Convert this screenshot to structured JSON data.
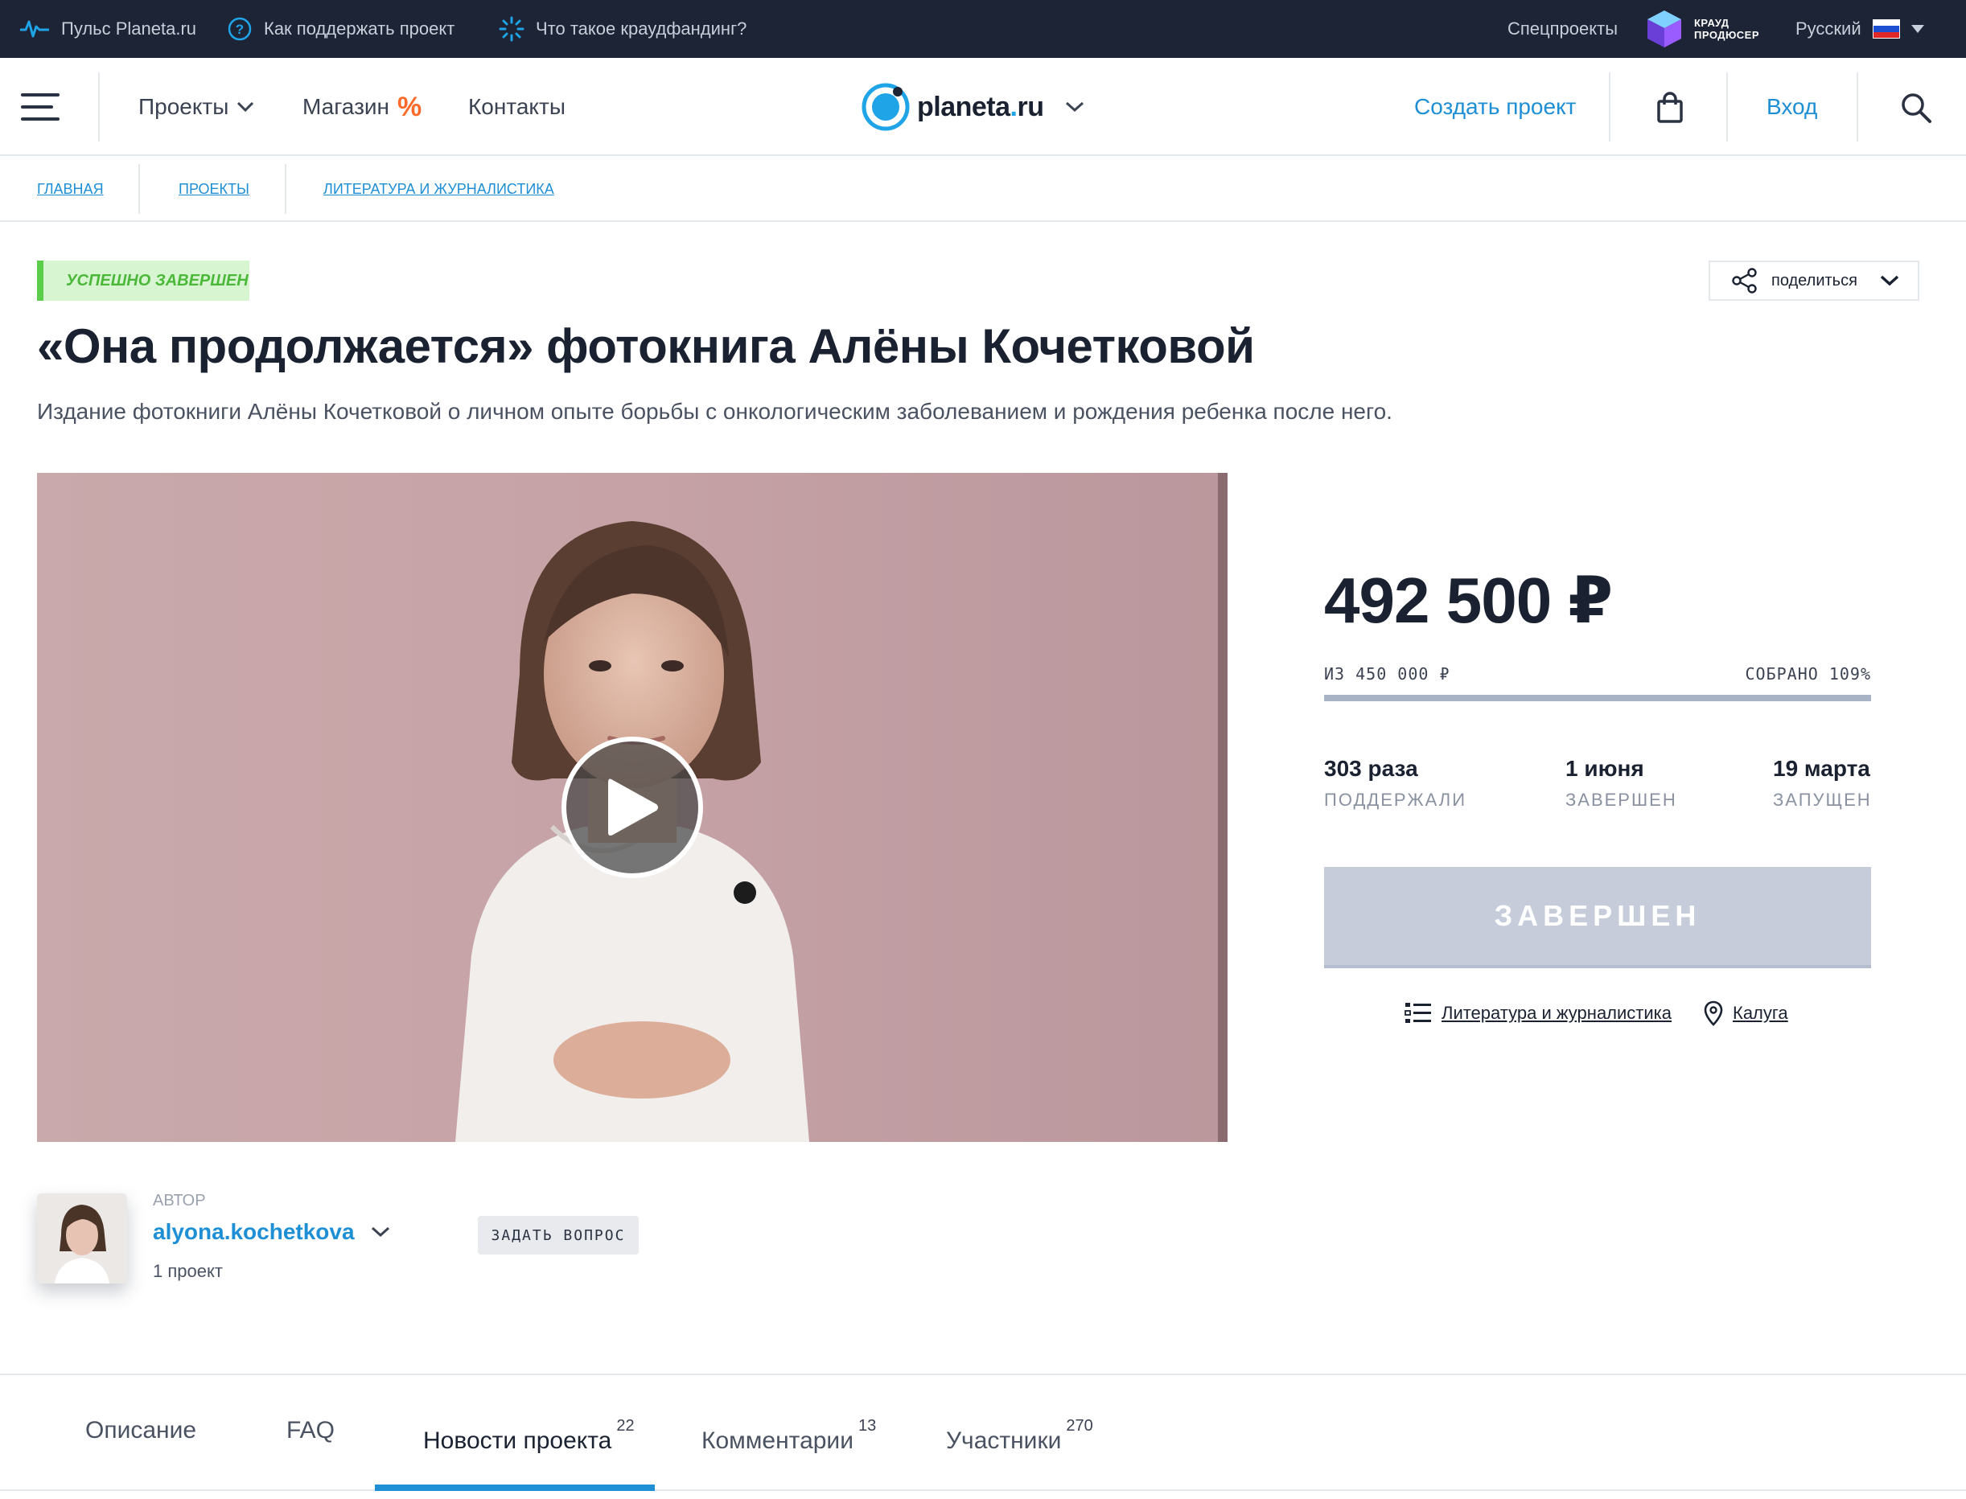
{
  "topbar": {
    "pulse": "Пульс Planeta.ru",
    "support": "Как поддержать проект",
    "crowdfunding": "Что такое краудфандинг?",
    "special": "Спецпроекты",
    "producer": "КРАУД\nПРОДЮСЕР",
    "language": "Русский",
    "colors": {
      "background": "#1c2436",
      "accent": "#1fa4e8"
    }
  },
  "header": {
    "nav": {
      "projects": "Проекты",
      "shop": "Магазин",
      "shop_badge": "%",
      "contacts": "Контакты"
    },
    "logo": {
      "name": "planeta",
      "dot": ".",
      "tld": "ru"
    },
    "create_project": "Создать проект",
    "login": "Вход",
    "icons": [
      "menu-icon",
      "chevron-down-icon",
      "bag-icon",
      "search-icon"
    ]
  },
  "breadcrumbs": [
    "ГЛАВНАЯ",
    "ПРОЕКТЫ",
    "ЛИТЕРАТУРА И ЖУРНАЛИСТИКА"
  ],
  "project": {
    "status": "УСПЕШНО ЗАВЕРШЕН",
    "share": "поделиться",
    "title": "«Она продолжается» фотокнига Алёны Кочетковой",
    "subtitle": "Издание фотокниги Алёны Кочетковой о личном опыте борьбы с онкологическим заболеванием и рождения ребенка после него."
  },
  "stats": {
    "amount": "492 500 ₽",
    "goal": "ИЗ 450 000 ₽",
    "collected": "СОБРАНО 109%",
    "progress_fraction": 1.0,
    "backers_value": "303 раза",
    "backers_label": "ПОДДЕРЖАЛИ",
    "finished_value": "1 июня",
    "finished_label": "ЗАВЕРШЕН",
    "launched_value": "19 марта",
    "launched_label": "ЗАПУЩЕН",
    "button": "ЗАВЕРШЕН",
    "category": "Литература и журналистика",
    "city": "Калуга"
  },
  "author": {
    "label": "АВТОР",
    "name": "alyona.kochetkova",
    "projects": "1 проект",
    "ask": "ЗАДАТЬ ВОПРОС"
  },
  "tabs": [
    {
      "label": "Описание",
      "count": ""
    },
    {
      "label": "FAQ",
      "count": ""
    },
    {
      "label": "Новости проекта",
      "count": "22",
      "active": true
    },
    {
      "label": "Комментарии",
      "count": "13"
    },
    {
      "label": "Участники",
      "count": "270"
    }
  ]
}
